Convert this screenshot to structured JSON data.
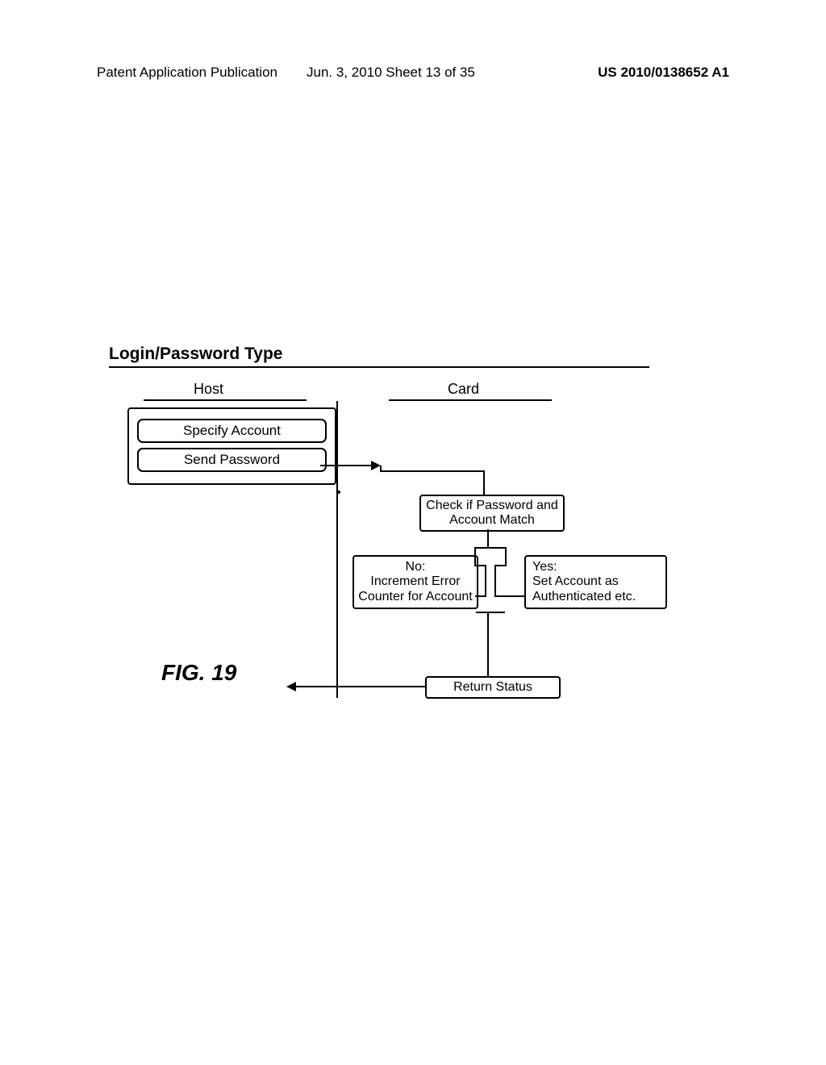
{
  "header": {
    "publication": "Patent Application Publication",
    "date_sheet": "Jun. 3, 2010  Sheet 13 of 35",
    "pub_number": "US 2010/0138652 A1"
  },
  "title": "Login/Password Type",
  "columns": {
    "host": "Host",
    "card": "Card"
  },
  "host_steps": {
    "specify": "Specify Account",
    "send": "Send Password"
  },
  "card_steps": {
    "check": "Check if Password and Account Match",
    "no": "No:\nIncrement Error Counter for Account",
    "yes": "Yes:\nSet Account as Authenticated etc.",
    "return": "Return Status"
  },
  "figure_label": "FIG. 19",
  "chart_data": {
    "type": "diagram",
    "title": "Login/Password Type",
    "lanes": [
      "Host",
      "Card"
    ],
    "nodes": [
      {
        "id": "specify",
        "lane": "Host",
        "text": "Specify Account"
      },
      {
        "id": "send",
        "lane": "Host",
        "text": "Send Password"
      },
      {
        "id": "check",
        "lane": "Card",
        "text": "Check if Password and Account Match"
      },
      {
        "id": "no",
        "lane": "Card",
        "text": "No: Increment Error Counter for Account"
      },
      {
        "id": "yes",
        "lane": "Card",
        "text": "Yes: Set Account as Authenticated etc."
      },
      {
        "id": "return",
        "lane": "Card",
        "text": "Return Status"
      }
    ],
    "edges": [
      {
        "from": "send",
        "to": "check"
      },
      {
        "from": "check",
        "to": "no",
        "label": "No"
      },
      {
        "from": "check",
        "to": "yes",
        "label": "Yes"
      },
      {
        "from": "no",
        "to": "return"
      },
      {
        "from": "return",
        "to": "Host",
        "note": "arrow back to Host lane"
      }
    ],
    "figure": "FIG. 19"
  }
}
